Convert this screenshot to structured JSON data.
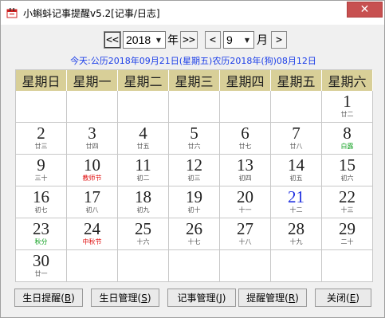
{
  "window": {
    "title": "小蝌蚪记事提醒v5.2[记事/日志]"
  },
  "nav": {
    "prev_year": "<<",
    "year_value": "2018",
    "year_label": "年",
    "next_year": ">>",
    "prev_month": "<",
    "month_value": "9",
    "month_label": "月",
    "next_month": ">"
  },
  "today_text": "今天:公历2018年09月21日(星期五)农历2018年(狗)08月12日",
  "weekdays": [
    "星期日",
    "星期一",
    "星期二",
    "星期三",
    "星期四",
    "星期五",
    "星期六"
  ],
  "days": [
    {
      "d": "",
      "l": ""
    },
    {
      "d": "",
      "l": ""
    },
    {
      "d": "",
      "l": ""
    },
    {
      "d": "",
      "l": ""
    },
    {
      "d": "",
      "l": ""
    },
    {
      "d": "",
      "l": ""
    },
    {
      "d": "1",
      "l": "廿二"
    },
    {
      "d": "2",
      "l": "廿三"
    },
    {
      "d": "3",
      "l": "廿四"
    },
    {
      "d": "4",
      "l": "廿五"
    },
    {
      "d": "5",
      "l": "廿六"
    },
    {
      "d": "6",
      "l": "廿七"
    },
    {
      "d": "7",
      "l": "廿八"
    },
    {
      "d": "8",
      "l": "白露",
      "lc": "green"
    },
    {
      "d": "9",
      "l": "三十"
    },
    {
      "d": "10",
      "l": "教师节",
      "lc": "red"
    },
    {
      "d": "11",
      "l": "初二"
    },
    {
      "d": "12",
      "l": "初三"
    },
    {
      "d": "13",
      "l": "初四"
    },
    {
      "d": "14",
      "l": "初五"
    },
    {
      "d": "15",
      "l": "初六"
    },
    {
      "d": "16",
      "l": "初七"
    },
    {
      "d": "17",
      "l": "初八"
    },
    {
      "d": "18",
      "l": "初九"
    },
    {
      "d": "19",
      "l": "初十"
    },
    {
      "d": "20",
      "l": "十一"
    },
    {
      "d": "21",
      "l": "十二",
      "today": true
    },
    {
      "d": "22",
      "l": "十三"
    },
    {
      "d": "23",
      "l": "秋分",
      "lc": "green"
    },
    {
      "d": "24",
      "l": "中秋节",
      "lc": "red"
    },
    {
      "d": "25",
      "l": "十六"
    },
    {
      "d": "26",
      "l": "十七"
    },
    {
      "d": "27",
      "l": "十八"
    },
    {
      "d": "28",
      "l": "十九"
    },
    {
      "d": "29",
      "l": "二十"
    },
    {
      "d": "30",
      "l": "廿一"
    },
    {
      "d": "",
      "l": ""
    },
    {
      "d": "",
      "l": ""
    },
    {
      "d": "",
      "l": ""
    },
    {
      "d": "",
      "l": ""
    },
    {
      "d": "",
      "l": ""
    },
    {
      "d": "",
      "l": ""
    }
  ],
  "buttons": {
    "birthday_remind": "生日提醒",
    "birthday_remind_key": "B",
    "birthday_manage": "生日管理",
    "birthday_manage_key": "S",
    "notes_manage": "记事管理",
    "notes_manage_key": "J",
    "reminder_manage": "提醒管理",
    "reminder_manage_key": "R",
    "close": "关闭",
    "close_key": "E"
  },
  "colors": {
    "header_bg": "#d8cf98",
    "today_blue": "#1f2fe0",
    "festival_red": "#e01010",
    "solar_term_green": "#10a020",
    "close_button_red": "#c75050"
  }
}
